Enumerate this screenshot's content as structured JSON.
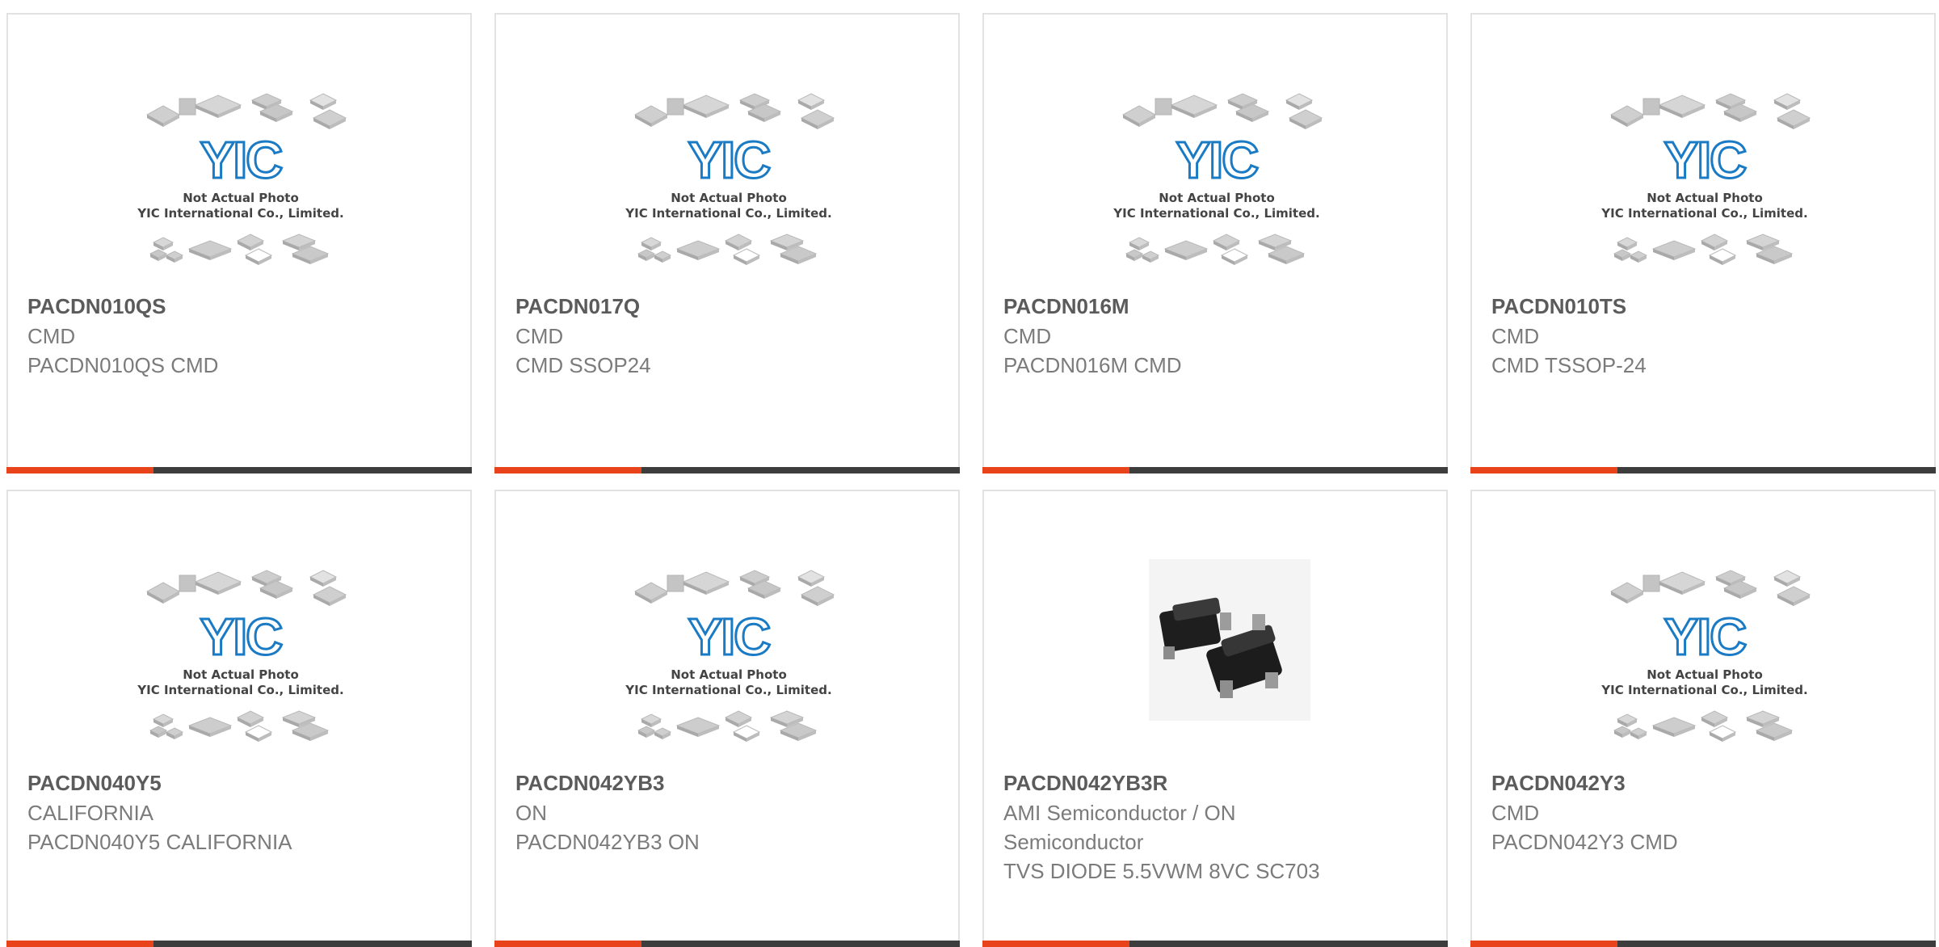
{
  "colors": {
    "accent": "#e8431a",
    "bar": "#3d3d3d",
    "logo_blue": "#1a7bc4",
    "title_text": "#5b5b5b",
    "body_text": "#7b7b7b"
  },
  "placeholder": {
    "logo_text": "YIC",
    "line1": "Not Actual Photo",
    "line2": "YIC International Co., Limited."
  },
  "products": [
    {
      "part": "PACDN010QS",
      "maker": "CMD",
      "desc": "PACDN010QS CMD",
      "image": "placeholder"
    },
    {
      "part": "PACDN017Q",
      "maker": "CMD",
      "desc": "CMD SSOP24",
      "image": "placeholder"
    },
    {
      "part": "PACDN016M",
      "maker": "CMD",
      "desc": "PACDN016M CMD",
      "image": "placeholder"
    },
    {
      "part": "PACDN010TS",
      "maker": "CMD",
      "desc": "CMD TSSOP-24",
      "image": "placeholder"
    },
    {
      "part": "PACDN040Y5",
      "maker": "CALIFORNIA",
      "desc": "PACDN040Y5 CALIFORNIA",
      "image": "placeholder"
    },
    {
      "part": "PACDN042YB3",
      "maker": "ON",
      "desc": "PACDN042YB3 ON",
      "image": "placeholder"
    },
    {
      "part": "PACDN042YB3R",
      "maker": "AMI Semiconductor / ON Semiconductor",
      "desc": "TVS DIODE 5.5VWM 8VC SC703",
      "image": "sot23-photo"
    },
    {
      "part": "PACDN042Y3",
      "maker": "CMD",
      "desc": "PACDN042Y3 CMD",
      "image": "placeholder"
    }
  ]
}
